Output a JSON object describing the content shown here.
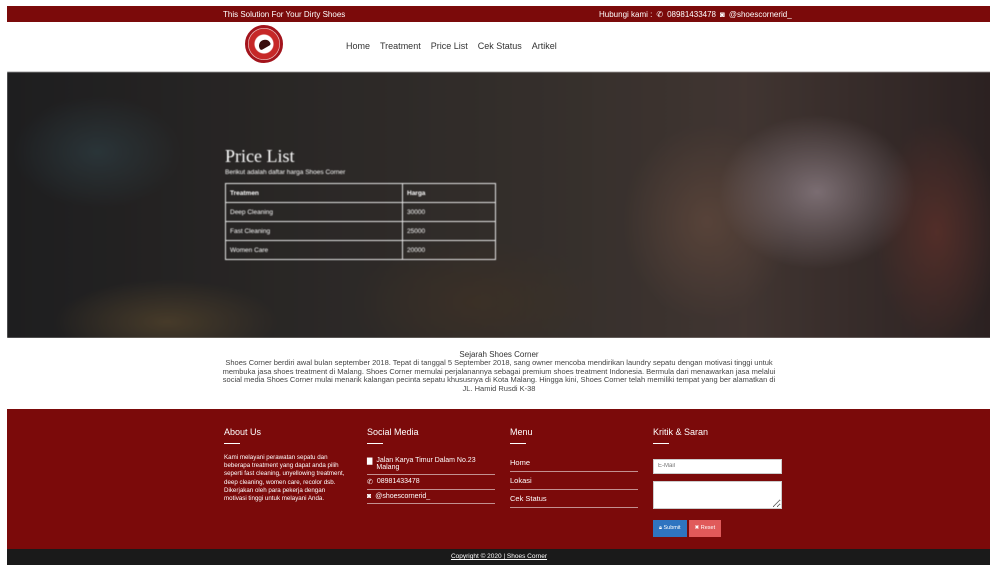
{
  "topbar": {
    "tagline": "This Solution For Your Dirty Shoes",
    "contact_label": "Hubungi kami :",
    "phone": "08981433478",
    "instagram": "@shoescornerid_"
  },
  "nav": {
    "items": [
      "Home",
      "Treatment",
      "Price List",
      "Cek Status",
      "Artikel"
    ]
  },
  "hero": {
    "title": "Price List",
    "subtitle": "Berikut adalah daftar harga Shoes Corner",
    "table": {
      "headers": [
        "Treatmen",
        "Harga"
      ],
      "rows": [
        [
          "Deep Cleaning",
          "30000"
        ],
        [
          "Fast Cleaning",
          "25000"
        ],
        [
          "Women Care",
          "20000"
        ]
      ]
    }
  },
  "history": {
    "title": "Sejarah Shoes Corner",
    "text": "Shoes Corner berdiri awal bulan september 2018. Tepat di tanggal 5 September 2018, sang owner mencoba mendirikan laundry sepatu dengan motivasi tinggi untuk membuka jasa shoes treatment di Malang. Shoes Corner memulai perjalanannya sebagai premium shoes treatment Indonesia. Bermula dari menawarkan jasa melalui social media Shoes Corner mulai menarik kalangan pecinta sepatu khususnya di Kota Malang. Hingga kini, Shoes Corner telah memiliki tempat yang ber alamatkan di JL. Hamid Rusdi K-38"
  },
  "footer": {
    "about": {
      "title": "About Us",
      "text": "Kami melayani perawatan sepatu dan beberapa treatment yang dapat anda pilih seperti fast cleaning, unyellowing treatment, deep cleaning, women care, recolor dsb. Dikerjakan oleh para pekerja dengan motivasi tinggi untuk melayani Anda."
    },
    "social": {
      "title": "Social Media",
      "address": "Jalan Karya Timur Dalam No.23 Malang",
      "whatsapp": "08981433478",
      "instagram": "@shoescornerid_"
    },
    "menu": {
      "title": "Menu",
      "items": [
        "Home",
        "Lokasi",
        "Cek Status"
      ]
    },
    "feedback": {
      "title": "Kritik & Saran",
      "email_placeholder": "E-Mail",
      "submit_label": "Submit",
      "reset_label": "Reset"
    }
  },
  "bottombar": {
    "copyright": "Copyright © 2020 | Shoes Corner"
  },
  "colors": {
    "brand": "#7b0a0a",
    "bottom_bar": "#1a1a1a",
    "submit": "#2f74c0",
    "reset": "#e05a5a"
  }
}
